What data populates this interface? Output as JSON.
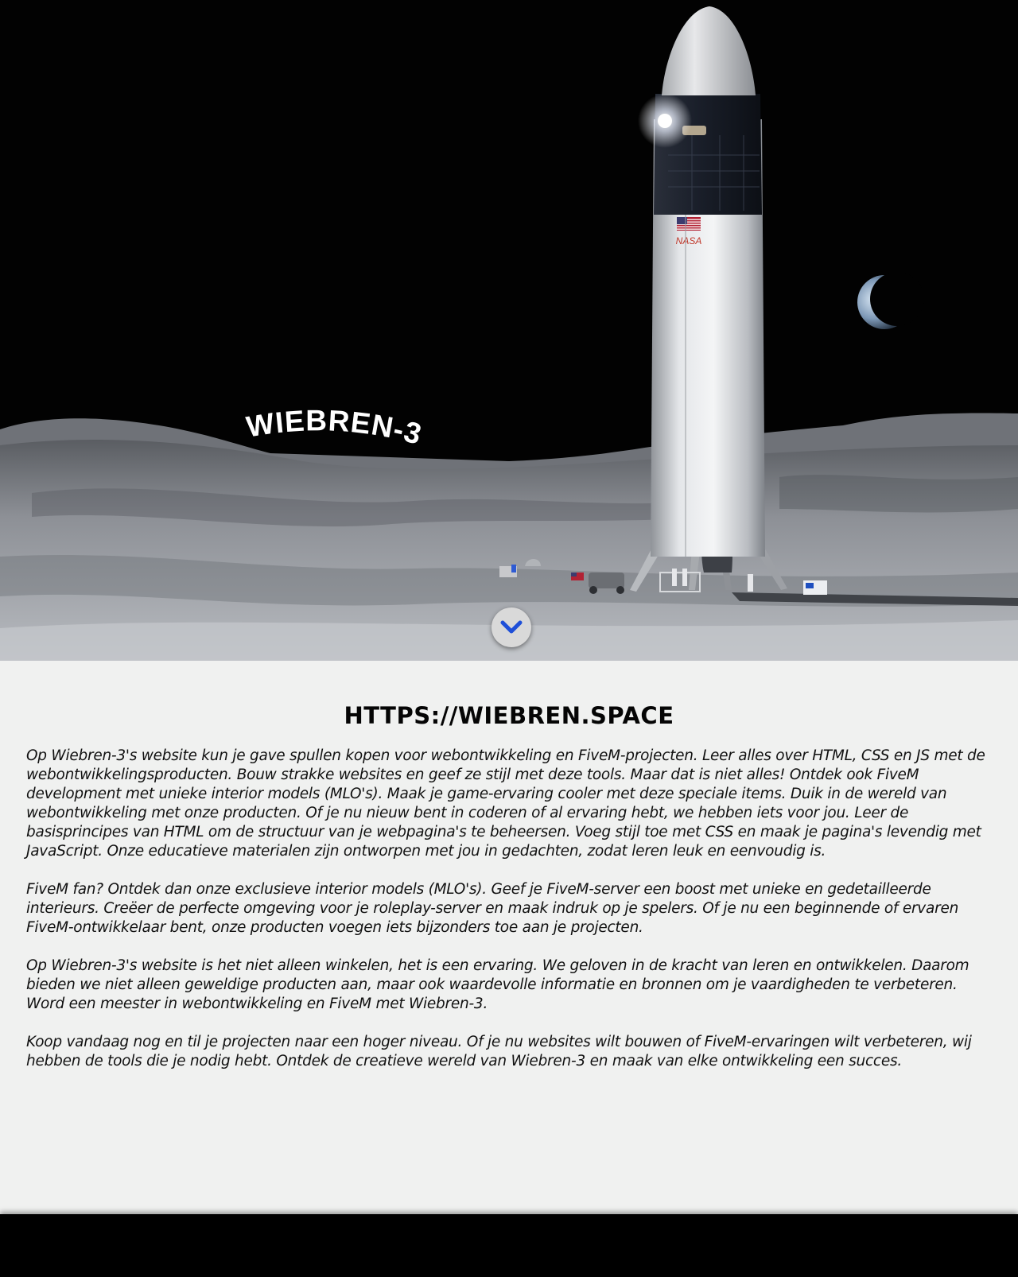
{
  "hero": {
    "logo_text": "WIEBREN-3",
    "rocket_marking": "NASA",
    "scroll_icon": "chevron-down-icon",
    "accent_color": "#1e4fd8"
  },
  "content": {
    "title": "HTTPS://WIEBREN.SPACE",
    "paragraphs": [
      "Op Wiebren-3's website kun je gave spullen kopen voor webontwikkeling en FiveM-projecten. Leer alles over HTML, CSS en JS met de webontwikkelingsproducten. Bouw strakke websites en geef ze stijl met deze tools. Maar dat is niet alles! Ontdek ook FiveM development met unieke interior models (MLO's). Maak je game-ervaring cooler met deze speciale items. Duik in de wereld van webontwikkeling met onze producten. Of je nu nieuw bent in coderen of al ervaring hebt, we hebben iets voor jou. Leer de basisprincipes van HTML om de structuur van je webpagina's te beheersen. Voeg stijl toe met CSS en maak je pagina's levendig met JavaScript. Onze educatieve materialen zijn ontworpen met jou in gedachten, zodat leren leuk en eenvoudig is.",
      "FiveM fan? Ontdek dan onze exclusieve interior models (MLO's). Geef je FiveM-server een boost met unieke en gedetailleerde interieurs. Creëer de perfecte omgeving voor je roleplay-server en maak indruk op je spelers. Of je nu een beginnende of ervaren FiveM-ontwikkelaar bent, onze producten voegen iets bijzonders toe aan je projecten.",
      "Op Wiebren-3's website is het niet alleen winkelen, het is een ervaring. We geloven in de kracht van leren en ontwikkelen. Daarom bieden we niet alleen geweldige producten aan, maar ook waardevolle informatie en bronnen om je vaardigheden te verbeteren. Word een meester in webontwikkeling en FiveM met Wiebren-3.",
      "Koop vandaag nog en til je projecten naar een hoger niveau. Of je nu websites wilt bouwen of FiveM-ervaringen wilt verbeteren, wij hebben de tools die je nodig hebt. Ontdek de creatieve wereld van Wiebren-3 en maak van elke ontwikkeling een succes."
    ]
  }
}
